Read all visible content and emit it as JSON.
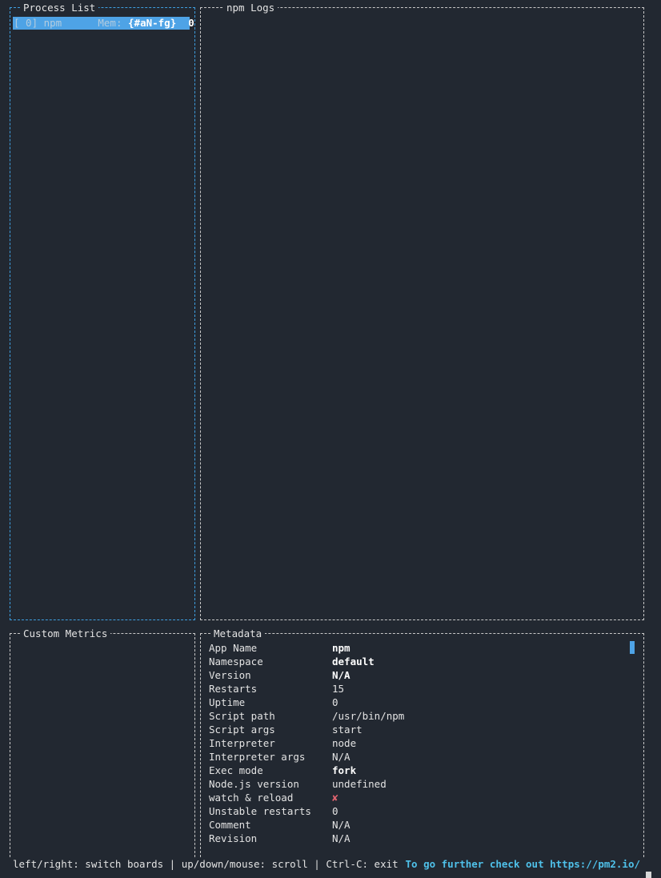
{
  "process_list": {
    "title": "Process List",
    "rows": [
      {
        "id_label": "[ 0] npm",
        "mem_label": "Mem:",
        "mem_value": "{#aN-fg}",
        "count": "0"
      }
    ]
  },
  "logs": {
    "title": "npm Logs"
  },
  "custom_metrics": {
    "title": "Custom Metrics"
  },
  "metadata": {
    "title": "Metadata",
    "rows": [
      {
        "key": "App Name",
        "value": "npm",
        "style": "bold"
      },
      {
        "key": "Namespace",
        "value": "default",
        "style": "bold"
      },
      {
        "key": "Version",
        "value": "N/A",
        "style": "bold"
      },
      {
        "key": "Restarts",
        "value": "15",
        "style": "normal"
      },
      {
        "key": "Uptime",
        "value": "0",
        "style": "normal"
      },
      {
        "key": "Script path",
        "value": "/usr/bin/npm",
        "style": "normal"
      },
      {
        "key": "Script args",
        "value": "start",
        "style": "normal"
      },
      {
        "key": "Interpreter",
        "value": "node",
        "style": "normal"
      },
      {
        "key": "Interpreter args",
        "value": "N/A",
        "style": "normal"
      },
      {
        "key": "Exec mode",
        "value": "fork",
        "style": "bold"
      },
      {
        "key": "Node.js version",
        "value": "undefined",
        "style": "normal"
      },
      {
        "key": "watch & reload",
        "value": "✘",
        "style": "cross"
      },
      {
        "key": "Unstable restarts",
        "value": "0",
        "style": "normal"
      },
      {
        "key": "Comment",
        "value": "N/A",
        "style": "normal"
      },
      {
        "key": "Revision",
        "value": "N/A",
        "style": "normal"
      }
    ]
  },
  "footer": {
    "help": "left/right: switch boards | up/down/mouse: scroll | Ctrl-C: exit",
    "link": "To go further check out https://pm2.io/"
  },
  "colors": {
    "background": "#222831",
    "focus_border": "#3f9fe0",
    "selection": "#4ea3e6",
    "link": "#4fc1ea",
    "cross": "#e06470"
  }
}
